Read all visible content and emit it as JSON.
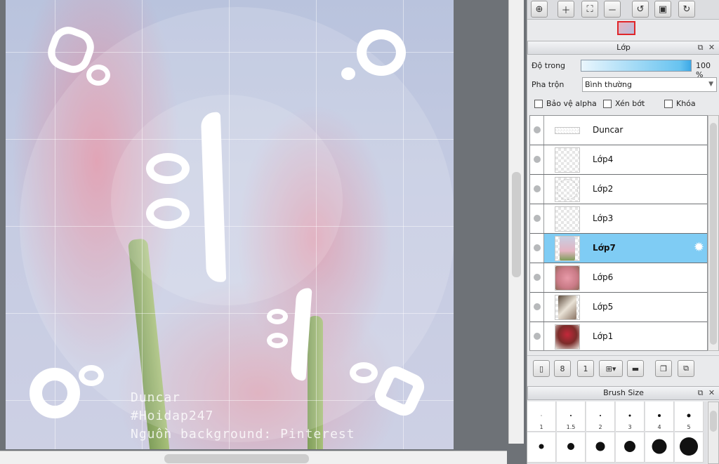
{
  "canvas": {
    "watermark": {
      "line1": "Duncar",
      "line2": "#Hoidap247",
      "line3": "Nguồn background: Pinterest"
    }
  },
  "navigator": {
    "tool_icons": [
      "zoom-fit-icon",
      "zoom-in-icon",
      "fit-window-icon",
      "zoom-out-icon",
      "rotate-left-icon",
      "actual-size-icon",
      "rotate-right-icon"
    ]
  },
  "layers_panel": {
    "title": "Lớp",
    "opacity_label": "Độ trong",
    "opacity_value": "100 %",
    "opacity_fraction": 1.0,
    "blend_label": "Pha trộn",
    "blend_value": "Bình thường",
    "checkboxes": {
      "protect_alpha": "Bảo vệ alpha",
      "clipping": "Xén bớt",
      "lock": "Khóa"
    },
    "layers": [
      {
        "name": "Duncar",
        "selected": false
      },
      {
        "name": "Lớp4",
        "selected": false
      },
      {
        "name": "Lớp2",
        "selected": false
      },
      {
        "name": "Lớp3",
        "selected": false
      },
      {
        "name": "Lớp7",
        "selected": true
      },
      {
        "name": "Lớp6",
        "selected": false
      },
      {
        "name": "Lớp5",
        "selected": false
      },
      {
        "name": "Lớp1",
        "selected": false
      }
    ],
    "selected_color": "#7fccf4"
  },
  "brush_panel": {
    "title": "Brush Size",
    "sizes": [
      "1",
      "1.5",
      "2",
      "3",
      "4",
      "5"
    ]
  }
}
